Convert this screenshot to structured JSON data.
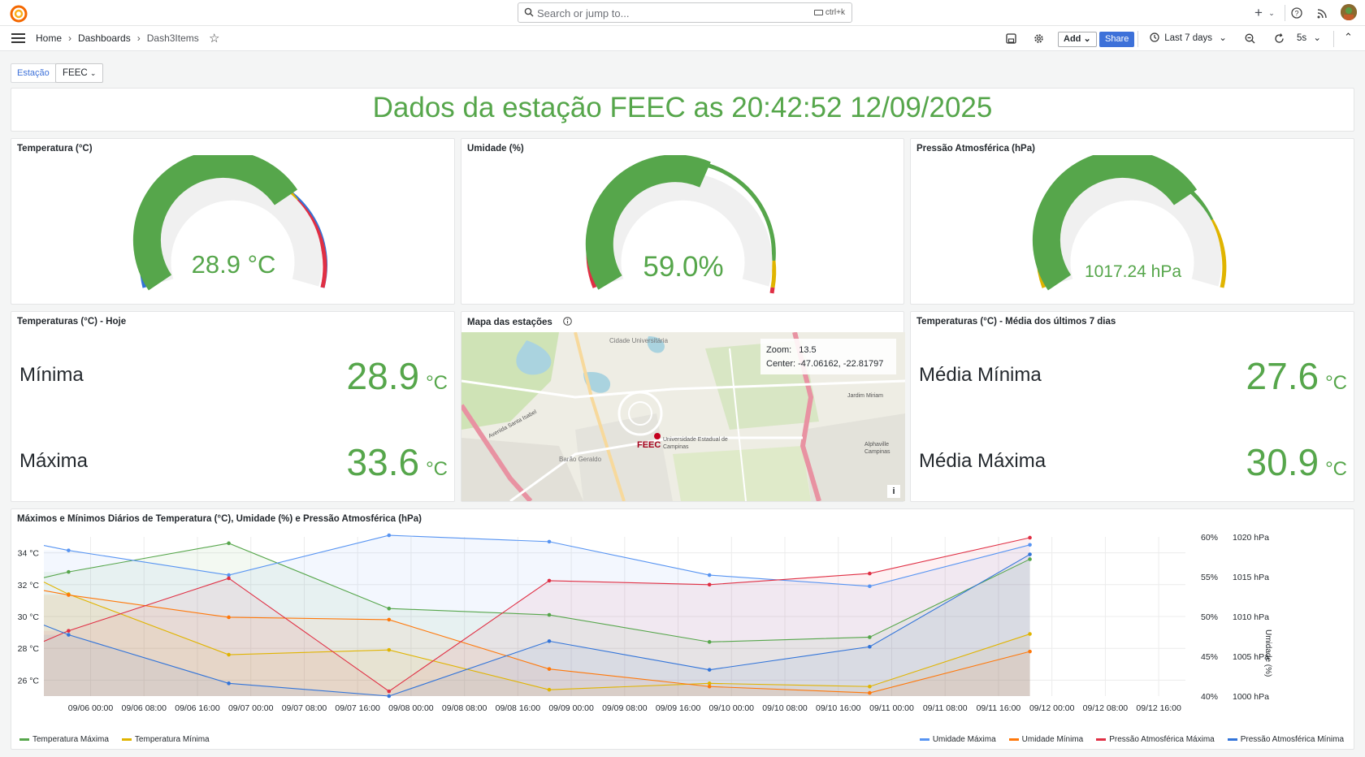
{
  "search": {
    "placeholder": "Search or jump to...",
    "shortcut": "ctrl+k"
  },
  "breadcrumbs": [
    "Home",
    "Dashboards",
    "Dash3Items"
  ],
  "toolbar": {
    "add_label": "Add",
    "share_label": "Share",
    "time_range": "Last 7 days",
    "refresh_interval": "5s"
  },
  "variable": {
    "label": "Estação",
    "value": "FEEC"
  },
  "headline": "Dados da estação FEEC as 20:42:52 12/09/2025",
  "gauges": [
    {
      "title": "Temperatura (°C)",
      "value": "28.9 °C",
      "fraction": 0.72
    },
    {
      "title": "Umidade (%)",
      "value": "59.0%",
      "fraction": 0.59
    },
    {
      "title": "Pressão Atmosférica (hPa)",
      "value": "1017.24 hPa",
      "fraction": 0.72
    }
  ],
  "today": {
    "title": "Temperaturas (°C) - Hoje",
    "min_label": "Mínima",
    "min_value": "28.9",
    "max_label": "Máxima",
    "max_value": "33.6",
    "unit": "°C"
  },
  "map": {
    "title": "Mapa das estações",
    "zoom_label": "Zoom:",
    "zoom_value": "13.5",
    "center_label": "Center:",
    "center_value": "-47.06162, -22.81797",
    "marker": "FEEC",
    "place_univ": "Cidade Universitária",
    "place_barao": "Barão Geraldo",
    "place_jardim": "Jardim Miriam",
    "place_unicamp": "Universidade Estadual de Campinas",
    "place_alphaville": "Alphaville Campinas",
    "place_avenida": "Avenida Santa Isabel",
    "info": "i"
  },
  "avg": {
    "title": "Temperaturas (°C) - Média dos últimos 7 dias",
    "min_label": "Média Mínima",
    "min_value": "27.6",
    "max_label": "Média Máxima",
    "max_value": "30.9",
    "unit": "°C"
  },
  "timeseries": {
    "title": "Máximos e Mínimos Diários de Temperatura (°C), Umidade (%) e Pressão Atmosférica (hPa)",
    "y_left_ticks": [
      "34 °C",
      "32 °C",
      "30 °C",
      "28 °C",
      "26 °C"
    ],
    "y_hum_ticks": [
      "60%",
      "55%",
      "50%",
      "45%",
      "40%"
    ],
    "y_press_ticks": [
      "1020 hPa",
      "1015 hPa",
      "1010 hPa",
      "1005 hPa",
      "1000 hPa"
    ],
    "y_right_label": "Umidade (%)",
    "x_ticks": [
      "09/06 00:00",
      "09/06 08:00",
      "09/06 16:00",
      "09/07 00:00",
      "09/07 08:00",
      "09/07 16:00",
      "09/08 00:00",
      "09/08 08:00",
      "09/08 16:00",
      "09/09 00:00",
      "09/09 08:00",
      "09/09 16:00",
      "09/10 00:00",
      "09/10 08:00",
      "09/10 16:00",
      "09/11 00:00",
      "09/11 08:00",
      "09/11 16:00",
      "09/12 00:00",
      "09/12 08:00",
      "09/12 16:00"
    ]
  },
  "chart_data": {
    "type": "line",
    "title": "Máximos e Mínimos Diários de Temperatura (°C), Umidade (%) e Pressão Atmosférica (hPa)",
    "x": [
      "09/05 20:42",
      "09/06 20:42",
      "09/07 20:42",
      "09/08 20:42",
      "09/09 20:42",
      "09/10 20:42",
      "09/11 20:42"
    ],
    "series": [
      {
        "name": "Temperatura Máxima",
        "axis": "°C",
        "color": "#56a64b",
        "values": [
          32.8,
          34.6,
          30.5,
          30.1,
          28.4,
          28.7,
          33.6
        ]
      },
      {
        "name": "Temperatura Mínima",
        "axis": "°C",
        "color": "#e0b400",
        "values": [
          31.4,
          27.6,
          27.9,
          25.4,
          25.8,
          25.6,
          28.9
        ]
      },
      {
        "name": "Umidade Máxima",
        "axis": "%",
        "color": "#5794f2",
        "values": [
          58.3,
          55.2,
          60.2,
          59.4,
          55.2,
          53.8,
          59.0
        ]
      },
      {
        "name": "Umidade Mínima",
        "axis": "%",
        "color": "#ff780a",
        "values": [
          52.7,
          49.9,
          49.6,
          43.4,
          41.2,
          40.4,
          45.6
        ]
      },
      {
        "name": "Pressão Atmosférica Máxima",
        "axis": "hPa",
        "color": "#e02f44",
        "values": [
          1008.2,
          1014.8,
          1000.6,
          1014.5,
          1014.0,
          1015.4,
          1019.9
        ]
      },
      {
        "name": "Pressão Atmosférica Mínima",
        "axis": "hPa",
        "color": "#3274d9",
        "values": [
          1007.7,
          1001.6,
          1000.0,
          1006.9,
          1003.3,
          1006.2,
          1017.8
        ]
      }
    ],
    "ylim_temp": [
      25,
      35
    ],
    "ylim_hum": [
      40,
      60
    ],
    "ylim_press": [
      1000,
      1020
    ],
    "legend_position": "bottom"
  }
}
